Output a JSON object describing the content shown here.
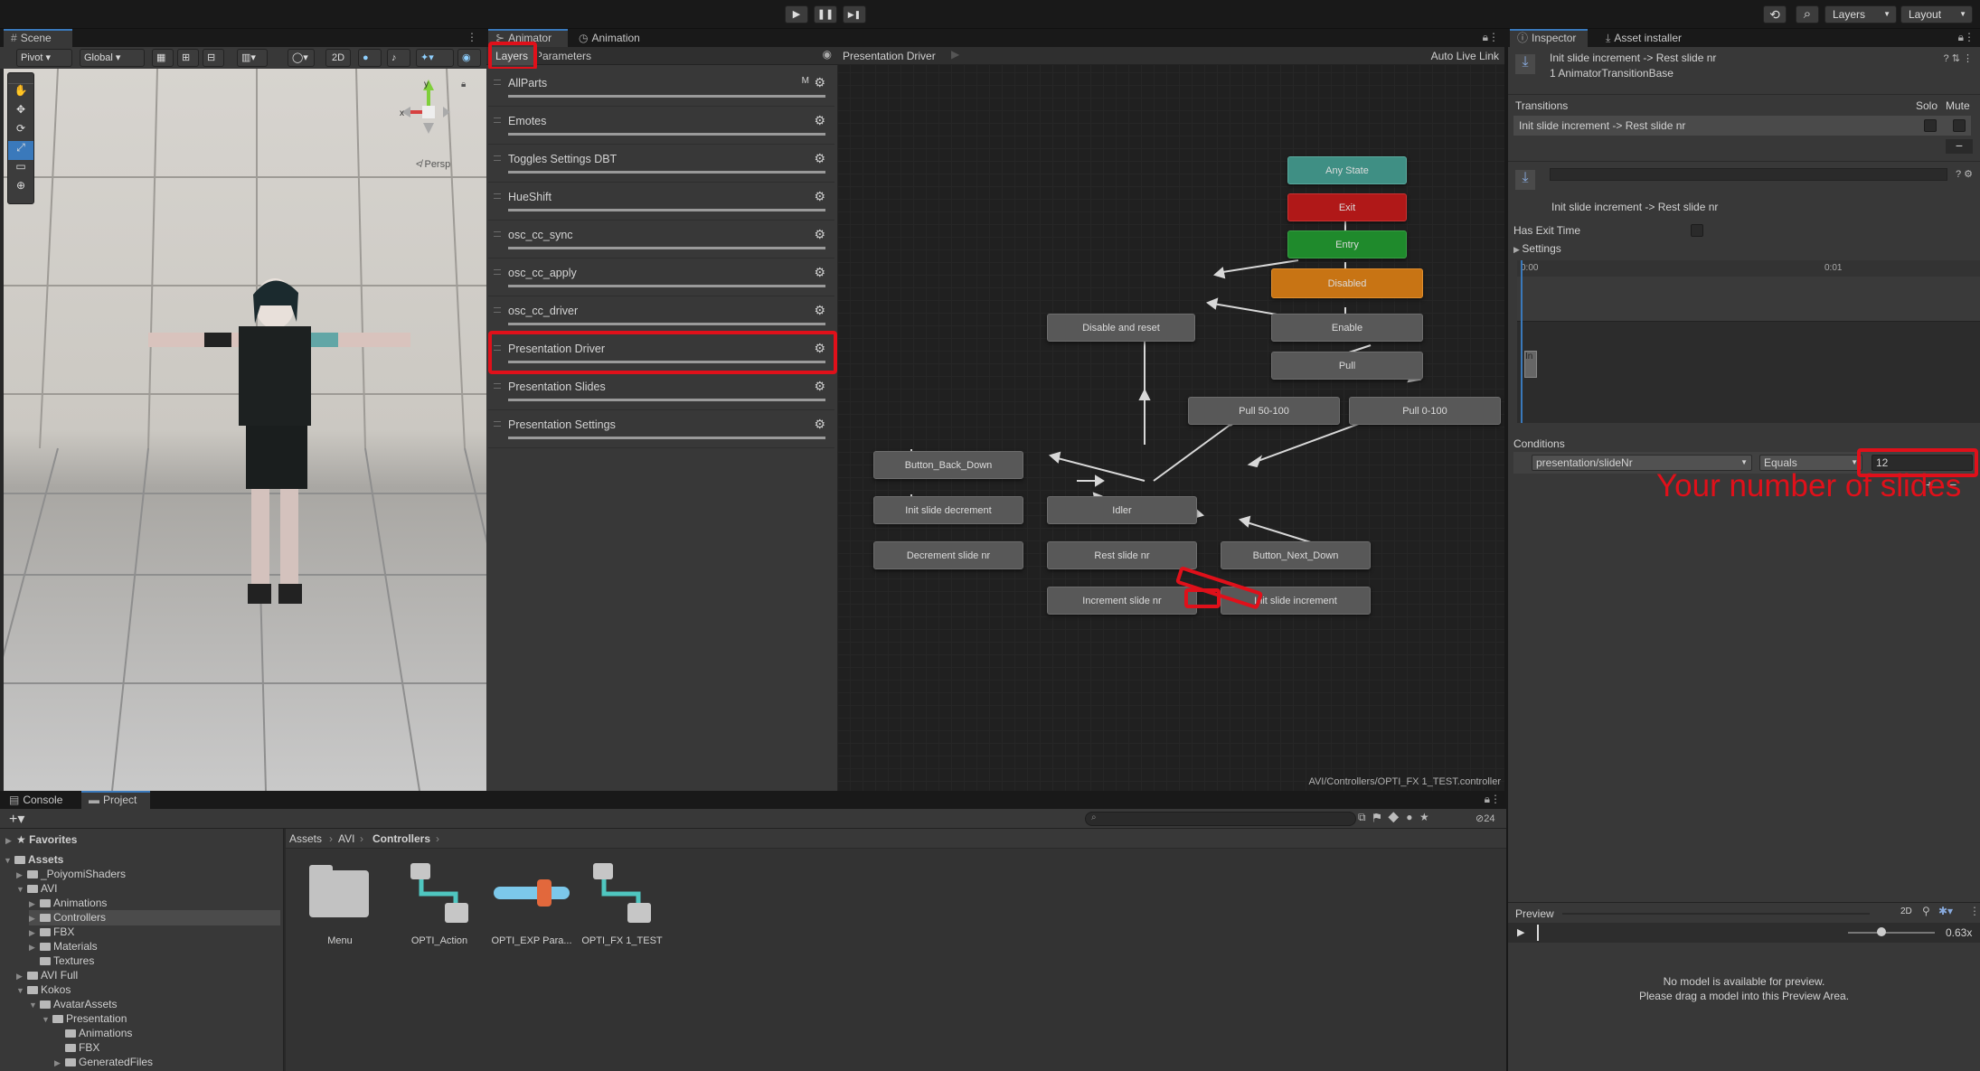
{
  "toolbar": {
    "play": "▶",
    "pause": "❚❚",
    "step": "▶❚",
    "history": "⟲",
    "search": "⌕",
    "layers_label": "Layers",
    "layout_label": "Layout"
  },
  "scene": {
    "tab_label": "Scene",
    "pivot_label": "Pivot",
    "global_label": "Global",
    "mode_2d": "2D",
    "persp_label": "≮ Persp",
    "gizmo_x": "x",
    "gizmo_y": "y"
  },
  "animator": {
    "tabs": [
      "Animator",
      "Animation"
    ],
    "sub_tabs": [
      "Layers",
      "Parameters"
    ],
    "breadcrumb": "Presentation Driver",
    "auto_live_link": "Auto Live Link",
    "add_button": "+",
    "layers": [
      {
        "name": "AllParts",
        "badge": "M"
      },
      {
        "name": "Emotes",
        "badge": ""
      },
      {
        "name": "Toggles Settings DBT",
        "badge": ""
      },
      {
        "name": "HueShift",
        "badge": ""
      },
      {
        "name": "osc_cc_sync",
        "badge": ""
      },
      {
        "name": "osc_cc_apply",
        "badge": ""
      },
      {
        "name": "osc_cc_driver",
        "badge": ""
      },
      {
        "name": "Presentation Driver",
        "badge": ""
      },
      {
        "name": "Presentation Slides",
        "badge": ""
      },
      {
        "name": "Presentation Settings",
        "badge": ""
      }
    ],
    "nodes": {
      "any_state": "Any State",
      "exit": "Exit",
      "entry": "Entry",
      "disabled": "Disabled",
      "disable_reset": "Disable and reset",
      "enable": "Enable",
      "pull": "Pull",
      "pull_50_100": "Pull 50-100",
      "pull_0_100": "Pull 0-100",
      "button_back_down": "Button_Back_Down",
      "init_slide_decrement": "Init slide decrement",
      "decrement_slide_nr": "Decrement slide nr",
      "idler": "Idler",
      "rest_slide_nr": "Rest slide nr",
      "button_next_down": "Button_Next_Down",
      "increment_slide_nr": "Increment slide nr",
      "init_slide_increment": "Init slide increment"
    },
    "footer_path": "AVI/Controllers/OPTI_FX 1_TEST.controller",
    "colors": {
      "any_state": "#3f8f84",
      "exit": "#b01818",
      "entry": "#1f8a2c",
      "disabled": "#c87414",
      "highlight": "#e0101a"
    }
  },
  "inspector": {
    "tabs": [
      "Inspector",
      "Asset installer"
    ],
    "title": "Init slide increment -> Rest slide nr",
    "subtitle": "1 AnimatorTransitionBase",
    "transitions_header": "Transitions",
    "solo_label": "Solo",
    "mute_label": "Mute",
    "transition_row": "Init slide increment -> Rest slide nr",
    "minus": "−",
    "transition_name": "Init slide increment -> Rest slide nr",
    "has_exit_time": "Has Exit Time",
    "settings_label": "Settings",
    "timeline_0": "0:00",
    "timeline_1": "0:01",
    "timeline_marker": "In",
    "conditions_header": "Conditions",
    "condition_param": "presentation/slideNr",
    "condition_mode": "Equals",
    "condition_value": "12",
    "add": "+",
    "remove": "−",
    "annotation": "Your number of slides",
    "preview_label": "Preview",
    "preview_2d": "2D",
    "preview_speed": "0.63x",
    "preview_msg_1": "No model is available for preview.",
    "preview_msg_2": "Please drag a model into this Preview Area."
  },
  "project": {
    "tabs": [
      "Console",
      "Project"
    ],
    "breadcrumb": [
      "Assets",
      "AVI",
      "Controllers"
    ],
    "hidden_count": "24",
    "favorites": "Favorites",
    "tree": [
      {
        "label": "Assets",
        "indent": 0,
        "open": true,
        "bold": true
      },
      {
        "label": "_PoiyomiShaders",
        "indent": 1,
        "open": false
      },
      {
        "label": "AVI",
        "indent": 1,
        "open": true
      },
      {
        "label": "Animations",
        "indent": 2,
        "open": false
      },
      {
        "label": "Controllers",
        "indent": 2,
        "open": false,
        "selected": true
      },
      {
        "label": "FBX",
        "indent": 2,
        "open": false
      },
      {
        "label": "Materials",
        "indent": 2,
        "open": false
      },
      {
        "label": "Textures",
        "indent": 2,
        "leaf": true
      },
      {
        "label": "AVI Full",
        "indent": 1,
        "open": false
      },
      {
        "label": "Kokos",
        "indent": 1,
        "open": true
      },
      {
        "label": "AvatarAssets",
        "indent": 2,
        "open": true
      },
      {
        "label": "Presentation",
        "indent": 3,
        "open": true
      },
      {
        "label": "Animations",
        "indent": 4,
        "leaf": true
      },
      {
        "label": "FBX",
        "indent": 4,
        "leaf": true
      },
      {
        "label": "GeneratedFiles",
        "indent": 4,
        "open": false
      }
    ],
    "assets": [
      "Menu",
      "OPTI_Action",
      "OPTI_EXP Para...",
      "OPTI_FX 1_TEST"
    ]
  }
}
